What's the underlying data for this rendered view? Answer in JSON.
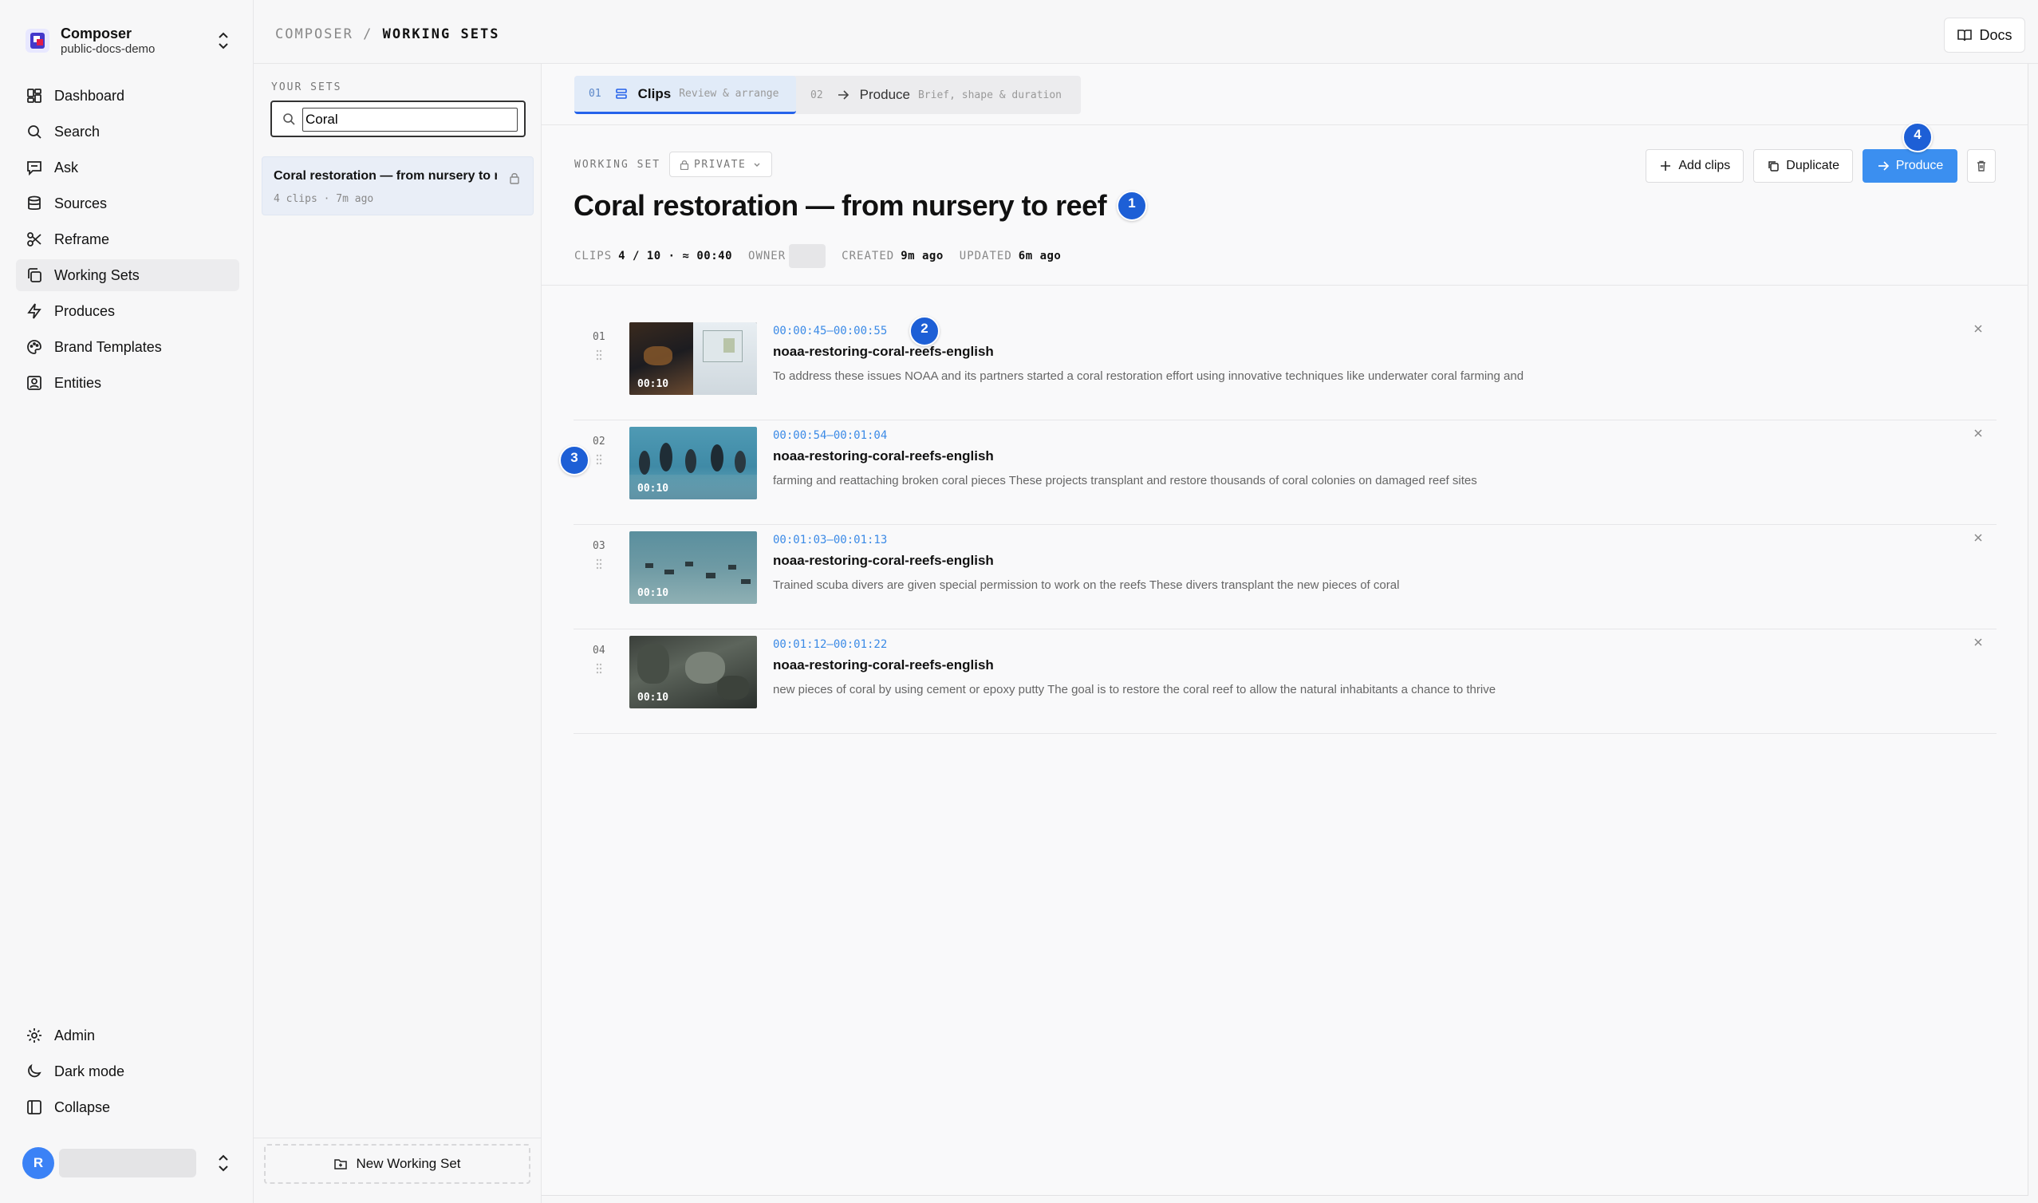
{
  "org": {
    "name": "Composer",
    "subtitle": "public-docs-demo"
  },
  "nav": {
    "items": [
      {
        "label": "Dashboard",
        "icon": "dashboard-icon"
      },
      {
        "label": "Search",
        "icon": "search-icon"
      },
      {
        "label": "Ask",
        "icon": "chat-icon"
      },
      {
        "label": "Sources",
        "icon": "database-icon"
      },
      {
        "label": "Reframe",
        "icon": "scissors-icon"
      },
      {
        "label": "Working Sets",
        "icon": "copy-icon",
        "active": true
      },
      {
        "label": "Produces",
        "icon": "bolt-icon"
      },
      {
        "label": "Brand Templates",
        "icon": "palette-icon"
      },
      {
        "label": "Entities",
        "icon": "contact-icon"
      }
    ],
    "bottom": [
      {
        "label": "Admin",
        "icon": "gear-icon"
      },
      {
        "label": "Dark mode",
        "icon": "moon-icon"
      },
      {
        "label": "Collapse",
        "icon": "sidebar-collapse-icon"
      }
    ]
  },
  "user": {
    "initial": "R"
  },
  "breadcrumb": {
    "root": "COMPOSER",
    "separator": " / ",
    "current": "WORKING SETS"
  },
  "docs_label": "Docs",
  "sets_panel": {
    "label": "YOUR SETS",
    "search_value": "Coral",
    "items": [
      {
        "title": "Coral restoration — from nursery to r...",
        "meta": "4 clips · 7m ago"
      }
    ],
    "new_button": "New Working Set"
  },
  "tabs": [
    {
      "num": "01",
      "label": "Clips",
      "sub": "Review & arrange",
      "active": true
    },
    {
      "num": "02",
      "label": "Produce",
      "sub": "Brief, shape & duration",
      "active": false
    }
  ],
  "working_set": {
    "label": "WORKING SET",
    "privacy": "PRIVATE",
    "title": "Coral restoration — from nursery to reef",
    "meta": {
      "clips_label": "CLIPS",
      "clips_value": "4 / 10 · ≈ 00:40",
      "owner_label": "OWNER",
      "created_label": "CREATED",
      "created_value": "9m ago",
      "updated_label": "UPDATED",
      "updated_value": "6m ago"
    }
  },
  "actions": {
    "add_clips": "Add clips",
    "duplicate": "Duplicate",
    "produce": "Produce"
  },
  "clips": [
    {
      "num": "01",
      "time": "00:00:45–00:00:55",
      "name": "noaa-restoring-coral-reefs-english",
      "text": "To address these issues NOAA and its partners started a coral restoration effort using innovative techniques like underwater coral farming and",
      "duration": "00:10"
    },
    {
      "num": "02",
      "time": "00:00:54–00:01:04",
      "name": "noaa-restoring-coral-reefs-english",
      "text": "farming and reattaching broken coral pieces These projects transplant and restore thousands of coral colonies on damaged reef sites",
      "duration": "00:10"
    },
    {
      "num": "03",
      "time": "00:01:03–00:01:13",
      "name": "noaa-restoring-coral-reefs-english",
      "text": "Trained scuba divers are given special permission to work on the reefs These divers transplant the new pieces of coral",
      "duration": "00:10"
    },
    {
      "num": "04",
      "time": "00:01:12–00:01:22",
      "name": "noaa-restoring-coral-reefs-english",
      "text": "new pieces of coral by using cement or epoxy putty The goal is to restore the coral reef to allow the natural inhabitants a chance to thrive",
      "duration": "00:10"
    }
  ],
  "badges": [
    "1",
    "2",
    "3",
    "4"
  ],
  "colors": {
    "accent": "#3b8ff0",
    "badge": "#1d5fd6",
    "active_tab": "#e1ebf8",
    "timecode": "#3b8ae6"
  }
}
